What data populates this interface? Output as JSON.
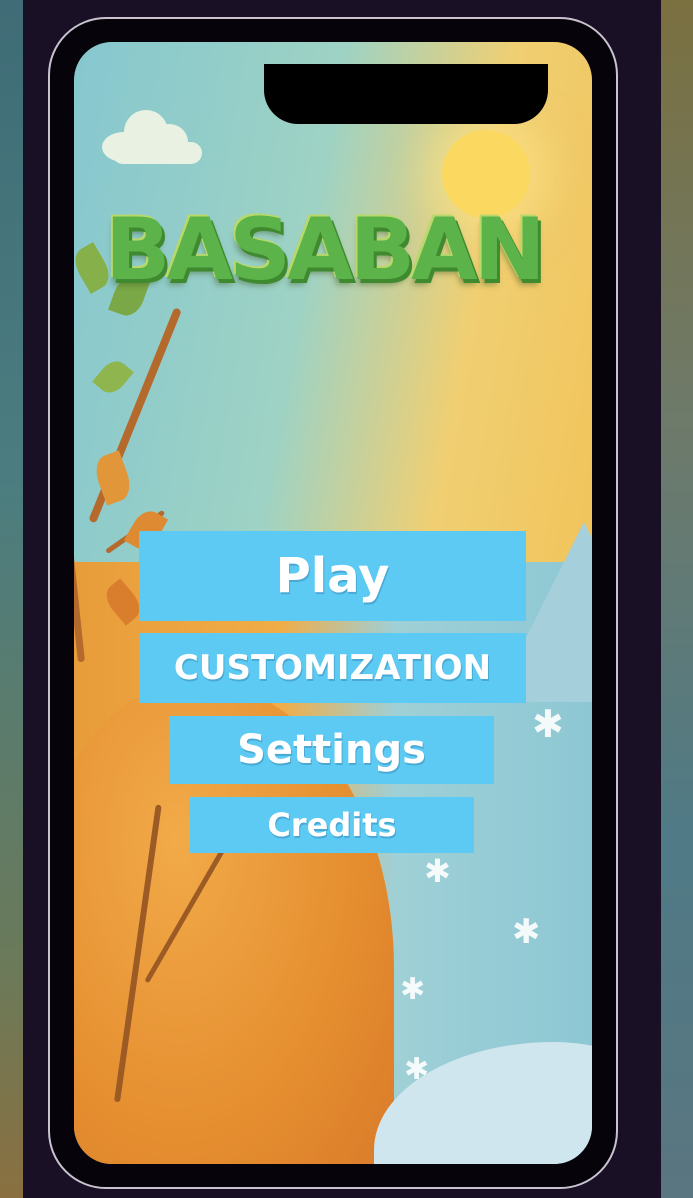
{
  "game": {
    "title": "BASABAN"
  },
  "menu": {
    "play_label": "Play",
    "customization_label": "CUSTOMIZATION",
    "settings_label": "Settings",
    "credits_label": "Credits"
  },
  "icons": {
    "cloud": "cloud-icon",
    "sun": "sun-icon",
    "snowflake": "snowflake-icon",
    "tree_branch": "tree-branch-icon",
    "mountain": "mountain-icon"
  },
  "colors": {
    "button_fill": "#5ccaf3",
    "button_text": "#ffffff",
    "title_green": "#5cb34a",
    "frame": "#1a1026"
  }
}
